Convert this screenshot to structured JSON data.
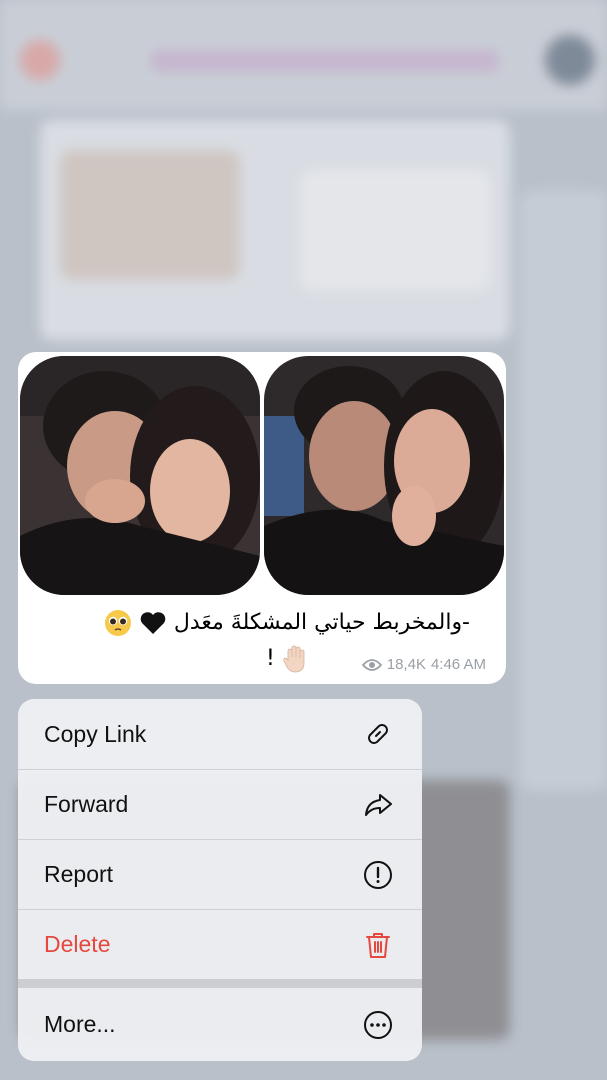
{
  "message": {
    "caption_line1": "-والمخربط حياتي المشكلةَ معَدل",
    "caption_line2": "!",
    "views": "18,4K",
    "time": "4:46 AM",
    "photos": [
      "couple-photo-1",
      "couple-photo-2"
    ]
  },
  "menu": {
    "items": [
      {
        "label": "Copy Link",
        "icon": "link-icon"
      },
      {
        "label": "Forward",
        "icon": "forward-arrow-icon"
      },
      {
        "label": "Report",
        "icon": "exclamation-circle-icon"
      },
      {
        "label": "Delete",
        "icon": "trash-icon",
        "color": "#e5483f"
      },
      {
        "label": "More...",
        "icon": "ellipsis-circle-icon"
      }
    ]
  },
  "colors": {
    "destructive": "#e5483f",
    "meta_gray": "#9aa0a6"
  }
}
